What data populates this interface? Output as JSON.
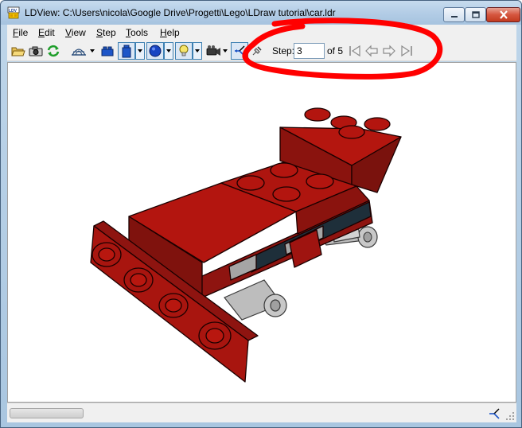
{
  "window": {
    "title": "LDView: C:\\Users\\nicola\\Google Drive\\Progetti\\Lego\\LDraw tutorial\\car.ldr"
  },
  "menu": {
    "items": [
      {
        "underline": "F",
        "rest": "ile"
      },
      {
        "underline": "E",
        "rest": "dit"
      },
      {
        "underline": "V",
        "rest": "iew"
      },
      {
        "underline": "S",
        "rest": "tep"
      },
      {
        "underline": "T",
        "rest": "ools"
      },
      {
        "underline": "H",
        "rest": "elp"
      }
    ]
  },
  "toolbar": {
    "step_label": "Step:",
    "step_value": "3",
    "of_label": "of 5"
  },
  "colors": {
    "annotation": "#ff0000",
    "brick": "#b3150f",
    "slate": "#1e2f3a",
    "gray": "#a5a5a5"
  }
}
